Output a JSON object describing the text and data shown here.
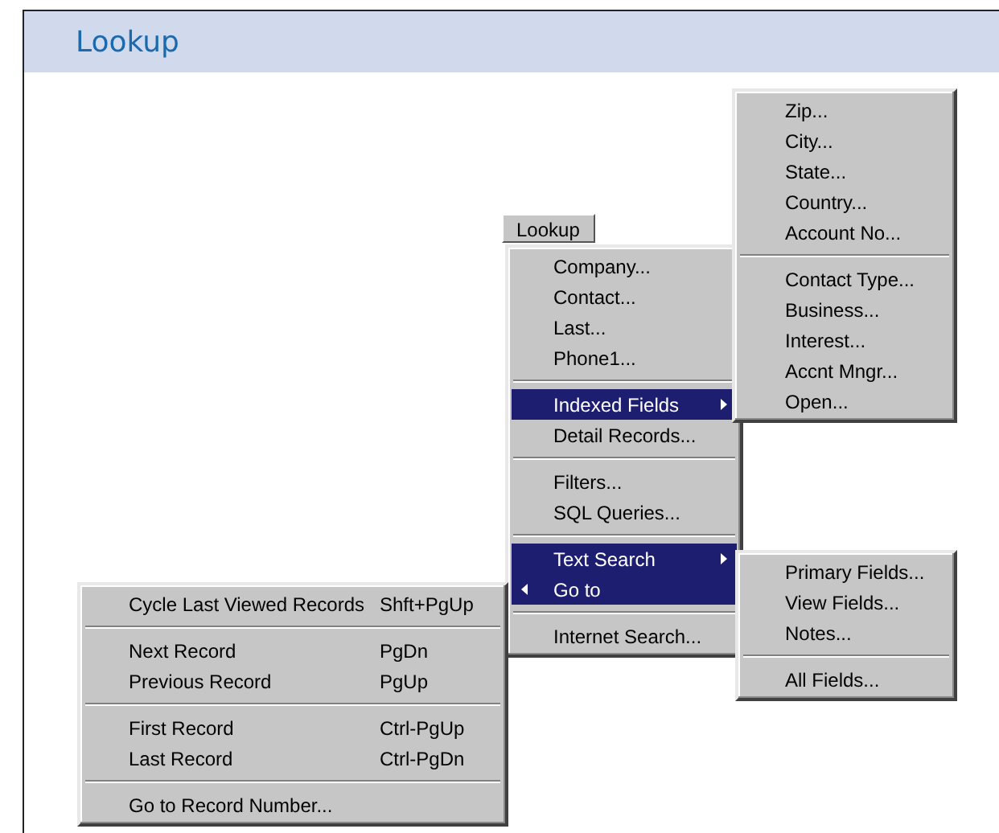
{
  "header": {
    "title": "Lookup"
  },
  "menu_bar": {
    "title": "Lookup"
  },
  "menus": [
    {
      "items": [
        {
          "kind": "item",
          "label": "Company...",
          "selected": false
        },
        {
          "kind": "item",
          "label": "Contact...",
          "selected": false
        },
        {
          "kind": "item",
          "label": "Last...",
          "selected": false
        },
        {
          "kind": "item",
          "label": "Phone1...",
          "selected": false
        },
        {
          "kind": "separator"
        },
        {
          "kind": "submenu_right",
          "label": "Indexed Fields",
          "selected": true
        },
        {
          "kind": "item",
          "label": "Detail Records...",
          "selected": false
        },
        {
          "kind": "separator"
        },
        {
          "kind": "item",
          "label": "Filters...",
          "selected": false
        },
        {
          "kind": "item",
          "label": "SQL Queries...",
          "selected": false
        },
        {
          "kind": "separator"
        },
        {
          "kind": "submenu_right",
          "label": "Text Search",
          "selected": true
        },
        {
          "kind": "submenu_left",
          "label": "Go to",
          "selected": true
        },
        {
          "kind": "separator"
        },
        {
          "kind": "item",
          "label": "Internet Search...",
          "selected": false
        }
      ]
    },
    {
      "items": [
        {
          "kind": "item",
          "label": "Zip...",
          "selected": false
        },
        {
          "kind": "item",
          "label": "City...",
          "selected": false
        },
        {
          "kind": "item",
          "label": "State...",
          "selected": false
        },
        {
          "kind": "item",
          "label": "Country...",
          "selected": false
        },
        {
          "kind": "item",
          "label": "Account No...",
          "selected": false
        },
        {
          "kind": "separator"
        },
        {
          "kind": "item",
          "label": "Contact Type...",
          "selected": false
        },
        {
          "kind": "item",
          "label": "Business...",
          "selected": false
        },
        {
          "kind": "item",
          "label": "Interest...",
          "selected": false
        },
        {
          "kind": "item",
          "label": "Accnt Mngr...",
          "selected": false
        },
        {
          "kind": "item",
          "label": "Open...",
          "selected": false
        }
      ]
    },
    {
      "items": [
        {
          "kind": "item",
          "label": "Primary Fields...",
          "selected": false
        },
        {
          "kind": "item",
          "label": "View Fields...",
          "selected": false
        },
        {
          "kind": "item",
          "label": "Notes...",
          "selected": false
        },
        {
          "kind": "separator"
        },
        {
          "kind": "item",
          "label": "All Fields...",
          "selected": false
        }
      ]
    },
    {
      "items": [
        {
          "kind": "item",
          "label": "Cycle Last Viewed Records",
          "shortcut": "Shft+PgUp",
          "selected": false
        },
        {
          "kind": "separator"
        },
        {
          "kind": "item",
          "label": "Next Record",
          "shortcut": "PgDn",
          "selected": false
        },
        {
          "kind": "item",
          "label": "Previous Record",
          "shortcut": "PgUp",
          "selected": false
        },
        {
          "kind": "separator"
        },
        {
          "kind": "item",
          "label": "First Record",
          "shortcut": "Ctrl-PgUp",
          "selected": false
        },
        {
          "kind": "item",
          "label": "Last Record",
          "shortcut": "Ctrl-PgDn",
          "selected": false
        },
        {
          "kind": "separator"
        },
        {
          "kind": "item",
          "label": "Go to Record Number...",
          "selected": false
        }
      ]
    }
  ]
}
